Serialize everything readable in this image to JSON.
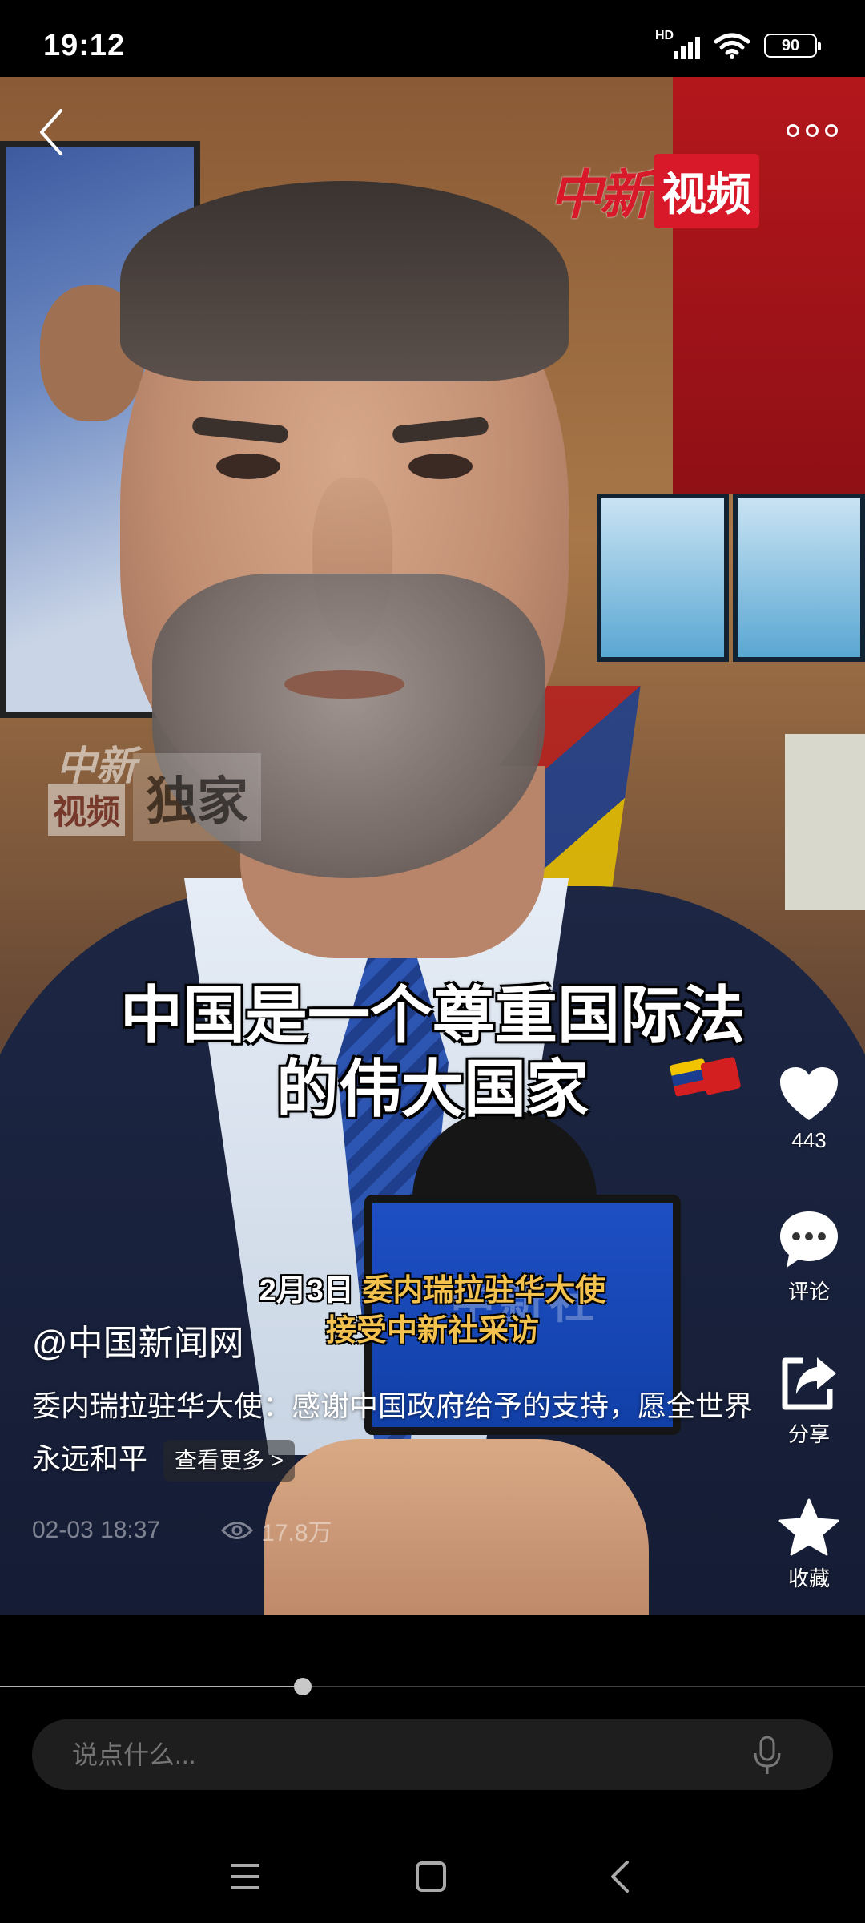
{
  "status_bar": {
    "time": "19:12",
    "network": "HD",
    "battery": "90"
  },
  "video": {
    "logo_script": "中新",
    "logo_box": "视频",
    "watermark_top": "中新",
    "watermark_left": "视频",
    "watermark_right": "独家",
    "subtitle_line1": "中国是一个尊重国际法",
    "subtitle_line2": "的伟大国家",
    "caption_date": "2月3日",
    "caption_line1": "委内瑞拉驻华大使",
    "caption_line2": "接受中新社采访",
    "mic_box_text": "中新社"
  },
  "actions": {
    "like_count": "443",
    "comment_label": "评论",
    "share_label": "分享",
    "favorite_label": "收藏"
  },
  "info": {
    "author": "@中国新闻网",
    "description": "委内瑞拉驻华大使：感谢中国政府给予的支持，愿全世界永远和平",
    "more_label": "查看更多 >",
    "date": "02-03 18:37",
    "views": "17.8万"
  },
  "player": {
    "progress_fraction": 0.35
  },
  "comment": {
    "placeholder": "说点什么..."
  },
  "icons": {
    "back": "back-arrow-icon",
    "more": "more-dots-icon",
    "like": "heart-icon",
    "comment": "chat-bubble-icon",
    "share": "share-icon",
    "favorite": "star-icon",
    "views": "eye-icon",
    "mic": "microphone-icon",
    "nav_menu": "menu-icon",
    "nav_home": "home-square-icon",
    "nav_back": "nav-back-icon"
  },
  "colors": {
    "brand_red": "#d8192a",
    "caption_yellow": "#f2c14e"
  }
}
